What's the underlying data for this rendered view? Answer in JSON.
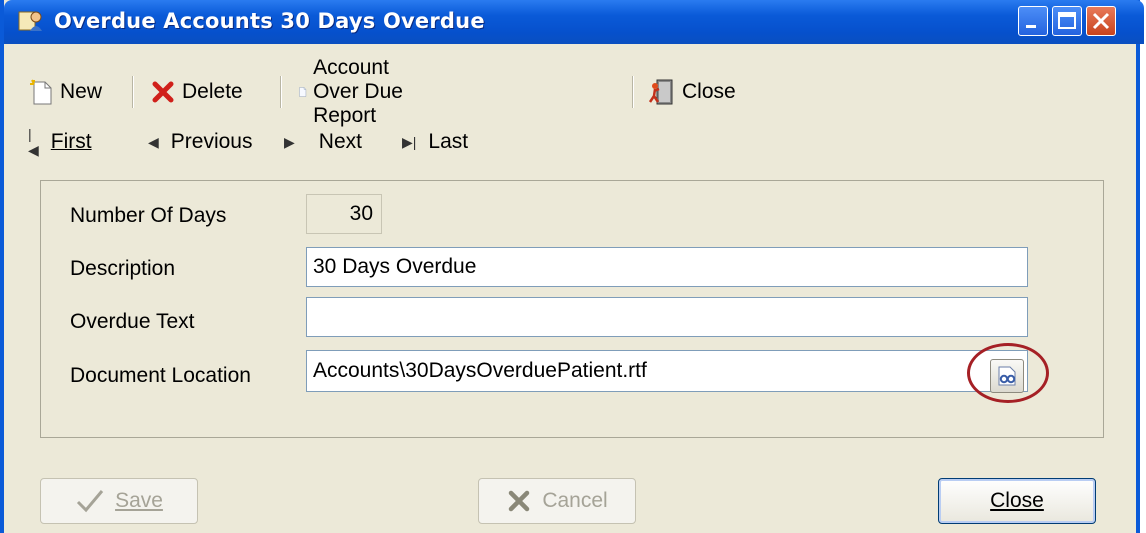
{
  "window": {
    "title": "Overdue Accounts 30 Days Overdue"
  },
  "toolbar": {
    "new_label": "New",
    "delete_label": "Delete",
    "report_label": "Account Over Due Report",
    "close_label": "Close"
  },
  "navigation": {
    "first_label": "First",
    "previous_label": "Previous",
    "next_label": "Next",
    "last_label": "Last"
  },
  "form": {
    "number_of_days_label": "Number Of Days",
    "number_of_days_value": "30",
    "description_label": "Description",
    "description_value": "30 Days Overdue",
    "overdue_text_label": "Overdue Text",
    "overdue_text_value": "",
    "document_location_label": "Document Location",
    "document_location_value": "Accounts\\30DaysOverduePatient.rtf"
  },
  "footer": {
    "save_label": "Save",
    "cancel_label": "Cancel",
    "close_label": "Close"
  },
  "colors": {
    "titlebar": "#0a5ad8",
    "window_bg": "#ece9d8",
    "highlight_circle": "#a52025"
  }
}
